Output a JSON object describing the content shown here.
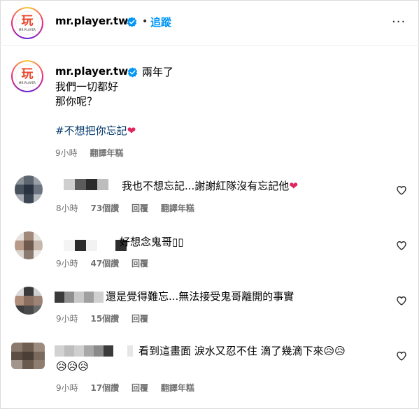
{
  "header": {
    "username": "mr.player.tw",
    "separator": "•",
    "follow_label": "追蹤",
    "more_label": "···"
  },
  "logo": {
    "mark": "玩",
    "sub": "MR.PLAYER"
  },
  "caption": {
    "username": "mr.player.tw",
    "lines": [
      "兩年了",
      "我們一切都好",
      "那你呢？",
      "",
      "#不想把你忘記"
    ],
    "emoji": "❤",
    "time": "9小時",
    "translate": "翻譯年糕"
  },
  "comments": [
    {
      "text": "我也不想忘記...謝謝紅隊沒有忘記他",
      "emoji": "❤",
      "time": "8小時",
      "likes": "73個讚",
      "reply": "回覆",
      "translate": "翻譯年糕"
    },
    {
      "text": "好想念鬼哥▯▯",
      "time": "9小時",
      "likes": "47個讚",
      "reply": "回覆"
    },
    {
      "text": "還是覺得難忘...無法接受鬼哥離開的事實",
      "time": "9小時",
      "likes": "15個讚",
      "reply": "回覆"
    },
    {
      "text": "看到這畫面 淚水又忍不住 滴了幾滴下來",
      "emoji_line1": "😥😥",
      "emoji_line2": "😥😥😥",
      "time": "9小時",
      "likes": "17個讚",
      "reply": "回覆",
      "translate": "翻譯年糕"
    }
  ],
  "colors": {
    "link_blue": "#0095f6",
    "hashtag": "#00376b",
    "meta_gray": "#737373",
    "heart_red": "#e0245e",
    "logo_red": "#e8442a"
  },
  "icons": [
    "verified-badge-icon",
    "more-icon",
    "heart-outline-icon"
  ]
}
